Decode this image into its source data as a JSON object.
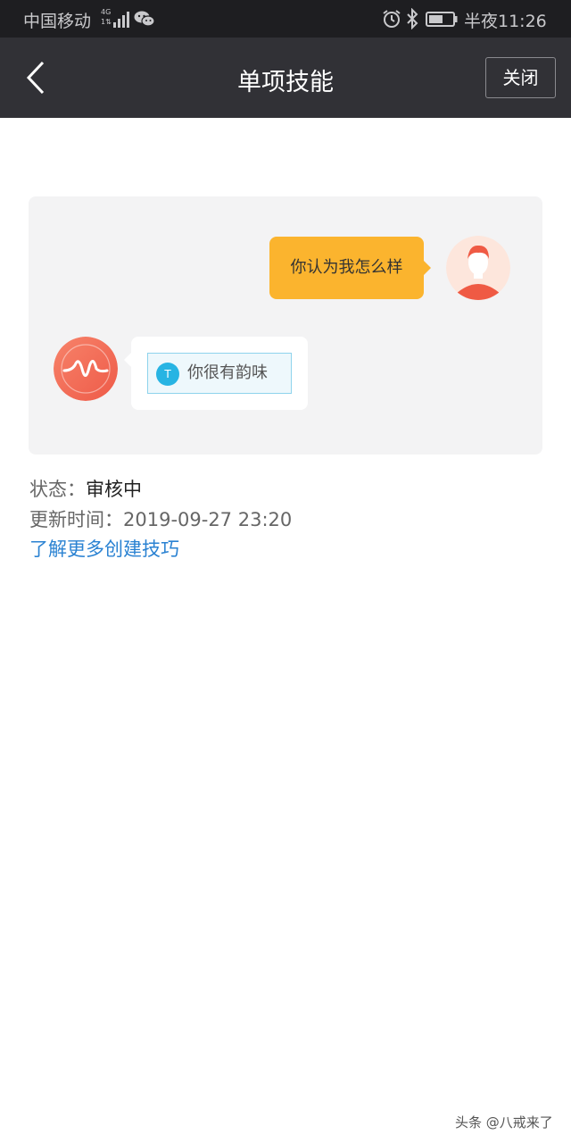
{
  "status_bar": {
    "carrier": "中国移动",
    "network_type": "4G",
    "network_sub": "1⇅",
    "time": "半夜11:26",
    "icons": [
      "signal-icon",
      "wechat-icon",
      "alarm-icon",
      "bluetooth-icon",
      "battery-icon"
    ]
  },
  "nav": {
    "title": "单项技能",
    "close_label": "关闭",
    "back_icon": "chevron-left-icon"
  },
  "chat": {
    "user_message": "你认为我怎么样",
    "bot_reply_icon_letter": "T",
    "bot_reply": "你很有韵味",
    "user_avatar": "user-avatar",
    "bot_avatar": "voice-wave-avatar"
  },
  "info": {
    "status_label": "状态：",
    "status_value": "审核中",
    "updated_label": "更新时间：",
    "updated_value": "2019-09-27 23:20",
    "more_link": "了解更多创建技巧"
  },
  "watermark": "头条 @八戒来了",
  "colors": {
    "status_bar_bg": "#1e1e21",
    "nav_bg": "#313136",
    "user_bubble": "#fbb42e",
    "bot_avatar": "#f06a4f",
    "link": "#2a82d2",
    "reply_icon": "#27b4e3"
  }
}
